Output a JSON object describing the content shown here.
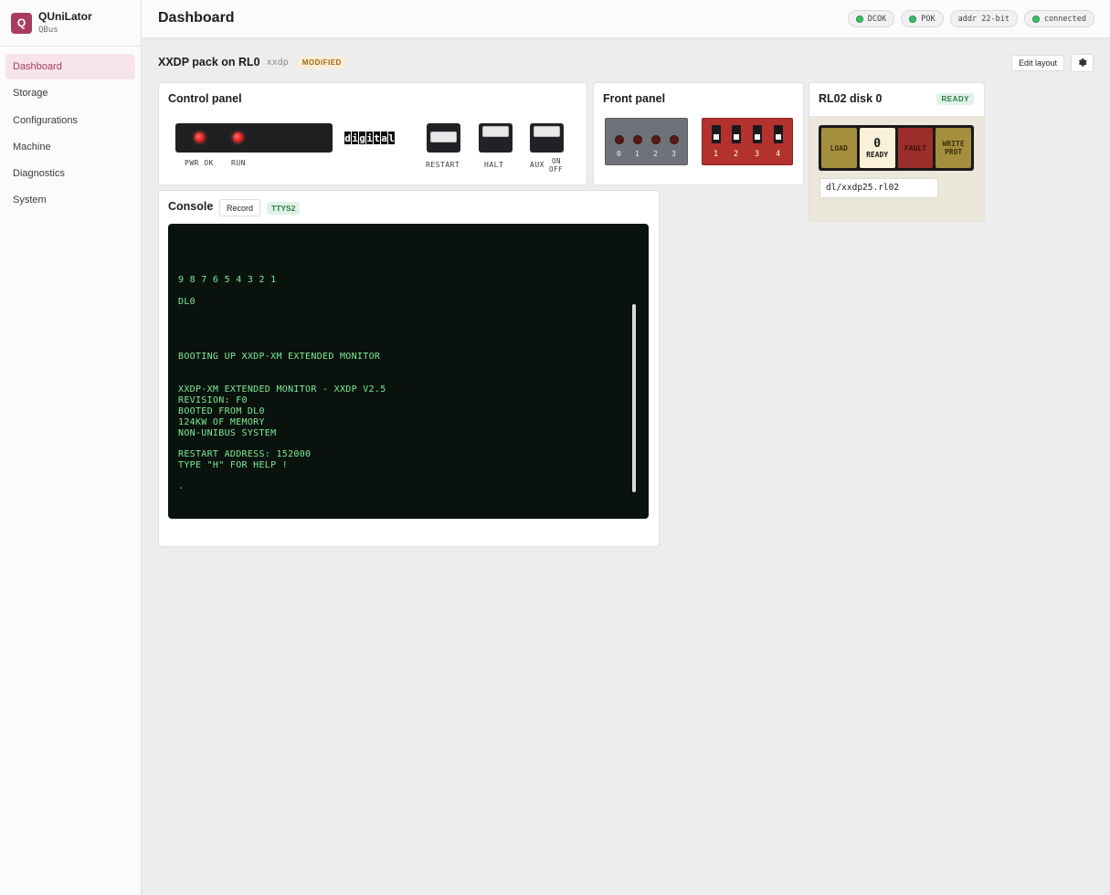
{
  "app": {
    "name": "QUniLator",
    "subtitle": "QBus",
    "logo_letter": "Q"
  },
  "sidebar": {
    "items": [
      {
        "label": "Dashboard",
        "active": true
      },
      {
        "label": "Storage"
      },
      {
        "label": "Configurations"
      },
      {
        "label": "Machine"
      },
      {
        "label": "Diagnostics"
      },
      {
        "label": "System"
      }
    ]
  },
  "header": {
    "title": "Dashboard",
    "status": [
      {
        "label": "DCOK",
        "color": "#3ac06a"
      },
      {
        "label": "POK",
        "color": "#3ac06a"
      },
      {
        "label": "addr 22-bit"
      },
      {
        "label": "connected",
        "color": "#3ac06a"
      }
    ]
  },
  "pack": {
    "title": "XXDP pack on RL0",
    "subtitle": "xxdp",
    "badge": "MODIFIED",
    "edit_layout": "Edit layout",
    "settings_icon": "gear-icon"
  },
  "control_panel": {
    "title": "Control panel",
    "lamps": [
      "PWR OK",
      "RUN"
    ],
    "logo": [
      "d",
      "i",
      "g",
      "i",
      "t",
      "a",
      "l"
    ],
    "switches": [
      "RESTART",
      "HALT",
      "AUX"
    ],
    "aux_states": [
      "ON",
      "OFF"
    ]
  },
  "front_panel": {
    "title": "Front panel",
    "leds": [
      "0",
      "1",
      "2",
      "3"
    ],
    "dip_switches": [
      "1",
      "2",
      "3",
      "4"
    ]
  },
  "rl02": {
    "title": "RL02 disk 0",
    "badge": "READY",
    "buttons": {
      "load": "LOAD",
      "unit": "0",
      "ready": "READY",
      "fault": "FAULT",
      "write_prot_1": "WRITE",
      "write_prot_2": "PROT"
    },
    "path": "dl/xxdp25.rl02"
  },
  "console": {
    "title": "Console",
    "record": "Record",
    "badge": "TTYS2",
    "lines": [
      "9 8 7 6 5 4 3 2 1",
      "DL0",
      "BOOTING UP XXDP-XM EXTENDED MONITOR",
      "XXDP-XM EXTENDED MONITOR - XXDP V2.5",
      "REVISION: F0",
      "BOOTED FROM DL0",
      "124KW OF MEMORY",
      "NON-UNIBUS SYSTEM",
      "RESTART ADDRESS: 152000",
      "TYPE \"H\" FOR HELP !",
      "."
    ]
  }
}
